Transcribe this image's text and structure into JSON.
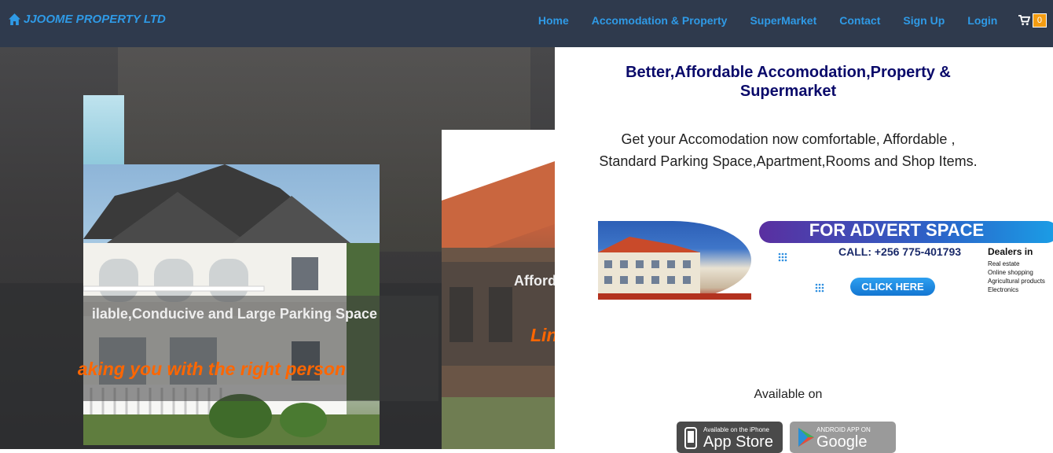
{
  "navbar": {
    "brand": "JJOOME PROPERTY LTD",
    "links": [
      "Home",
      "Accomodation & Property",
      "SuperMarket",
      "Contact",
      "Sign Up",
      "Login"
    ],
    "cart_count": "0"
  },
  "hero": {
    "slide1_title": "ilable,Conducive and Large Parking Space",
    "slide1_subtitle": "aking you with the right person",
    "slide2_title": "Afford",
    "slide2_subtitle": "Lin"
  },
  "main": {
    "headline": "Better,Affordable Accomodation,Property & Supermarket",
    "description_line1": "Get your Accomodation now comfortable, Affordable ,",
    "description_line2": "Standard Parking Space,Apartment,Rooms and Shop Items.",
    "advert": {
      "banner": "FOR ADVERT SPACE",
      "call": "CALL: +256 775-401793",
      "button": "CLICK HERE",
      "dealers_title": "Dealers in",
      "dealers_items": [
        "Real estate",
        "Online shopping",
        "Agricultural products",
        "Electronics"
      ]
    },
    "available_on": "Available on",
    "appstore_small": "Available on the iPhone",
    "appstore_big": "App Store",
    "googleplay_small": "ANDROID APP ON",
    "googleplay_big": "Google play"
  },
  "colors": {
    "navbar_bg": "#2f3a4d",
    "link": "#2f9ae6",
    "headline": "#0a0a6a",
    "accent_orange": "#ff6600",
    "badge": "#f39c12"
  }
}
